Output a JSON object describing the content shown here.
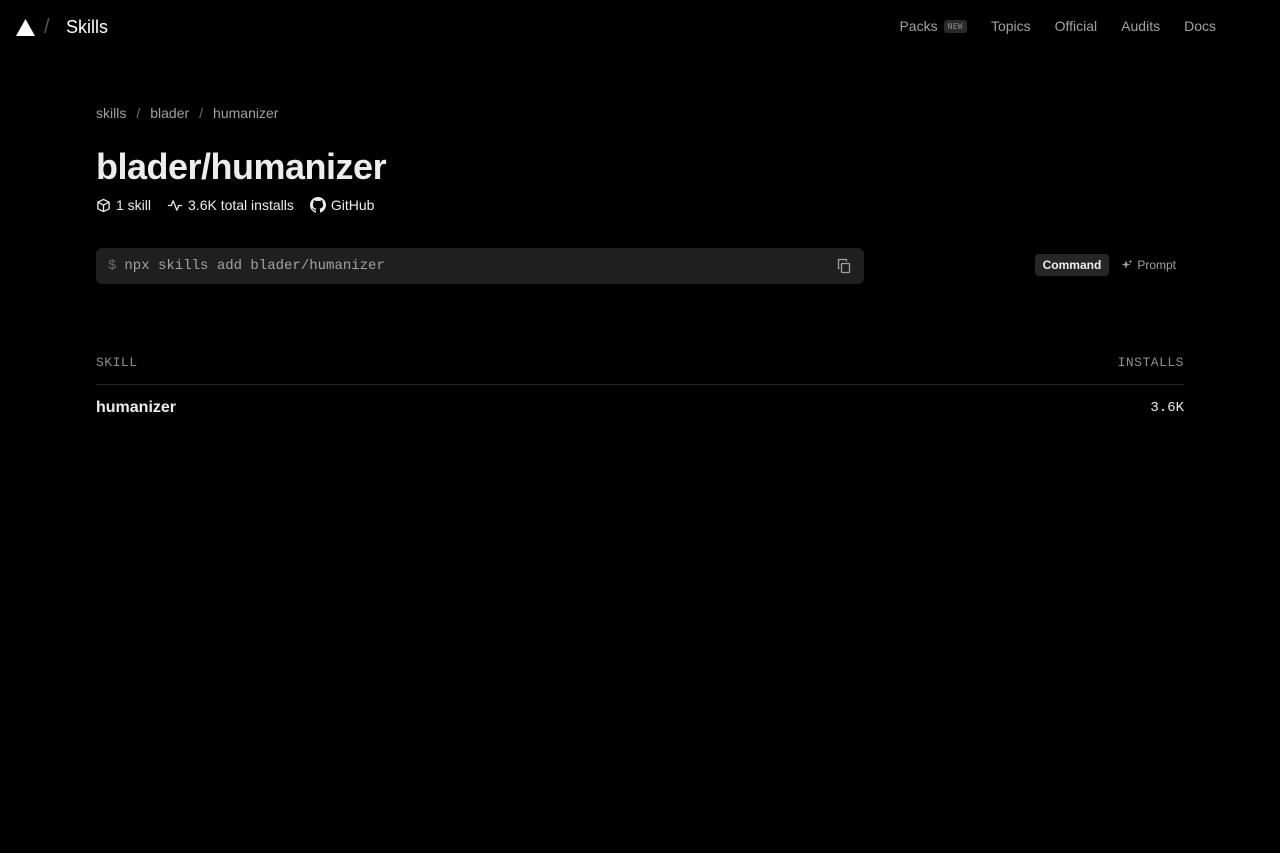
{
  "header": {
    "brand": "Skills",
    "separator": "/",
    "nav": [
      {
        "label": "Packs",
        "badge": "NEW"
      },
      {
        "label": "Topics"
      },
      {
        "label": "Official"
      },
      {
        "label": "Audits"
      },
      {
        "label": "Docs"
      }
    ]
  },
  "breadcrumb": {
    "items": [
      "skills",
      "blader",
      "humanizer"
    ],
    "separator": "/"
  },
  "repo": {
    "title": "blader/humanizer",
    "skills_count": "1 skill",
    "installs": "3.6K total installs",
    "github": "GitHub"
  },
  "command": {
    "prompt_symbol": "$",
    "text": "npx skills add blader/humanizer",
    "modes": [
      "Command",
      "Prompt"
    ],
    "active_mode": "Command"
  },
  "table": {
    "headers": [
      "SKILL",
      "INSTALLS"
    ],
    "rows": [
      {
        "name": "humanizer",
        "installs": "3.6K"
      }
    ]
  }
}
